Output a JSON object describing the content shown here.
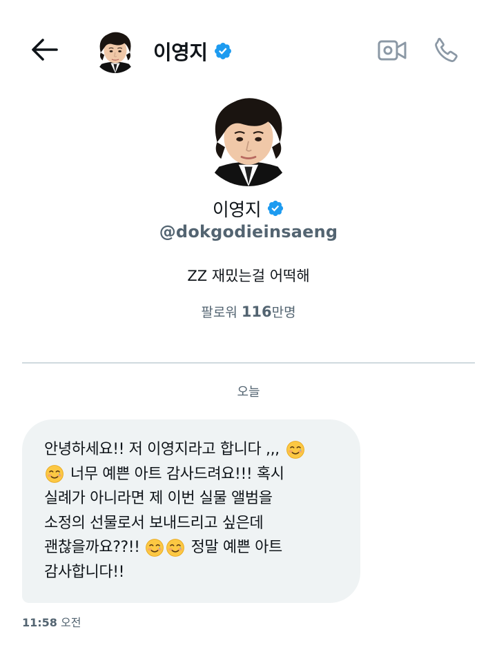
{
  "header": {
    "back_icon": "arrow-left-icon",
    "name": "이영지",
    "verified_icon": "verified-badge-icon",
    "video_icon": "video-camera-icon",
    "call_icon": "phone-icon"
  },
  "profile": {
    "name": "이영지",
    "handle": "@dokgodieinsaeng",
    "bio": "ZZ 재밌는걸 어떡해",
    "followers_label": "팔로워",
    "followers_count": "116",
    "followers_unit": "만명"
  },
  "chat": {
    "date_separator": "오늘",
    "message": {
      "lines": [
        "안녕하세요!! 저 이영지라고 합니다 ,,,",
        "너무 예쁜 아트 감사드려요!!! 혹시",
        "실례가 아니라면 제 이번 실물 앨범을",
        "소정의 선물로서 보내드리고 싶은데",
        "괜찮을까요??!!",
        "정말 예쁜 아트",
        "감사합니다!!"
      ],
      "emoji": "smiling-face-with-tear-icon",
      "time": "11:58",
      "period": "오전"
    }
  },
  "colors": {
    "accent": "#1d9bf0",
    "text": "#0f1419",
    "secondary": "#536471",
    "bubble": "#eff3f4",
    "divider": "#cfd9de"
  }
}
